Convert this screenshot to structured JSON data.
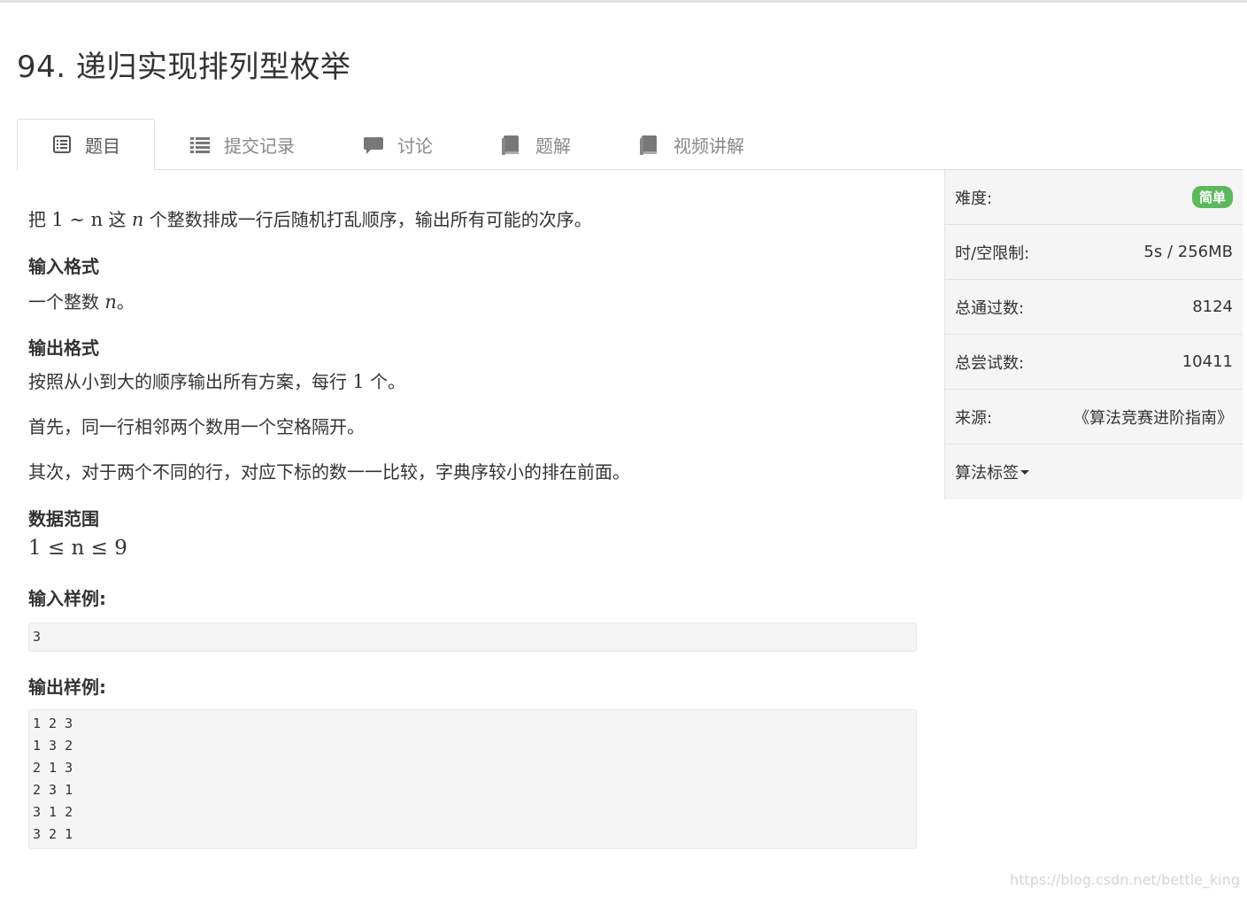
{
  "problem": {
    "title": "94. 递归实现排列型枚举"
  },
  "tabs": [
    {
      "label": "题目",
      "icon": "list-alt-icon",
      "active": true
    },
    {
      "label": "提交记录",
      "icon": "list-icon",
      "active": false
    },
    {
      "label": "讨论",
      "icon": "comment-icon",
      "active": false
    },
    {
      "label": "题解",
      "icon": "book-icon",
      "active": false
    },
    {
      "label": "视频讲解",
      "icon": "book-icon",
      "active": false
    }
  ],
  "statement": {
    "desc_pre": "把 ",
    "desc_math": "1 ∼ n",
    "desc_mid": " 这 ",
    "desc_math2": "n",
    "desc_post": " 个整数排成一行后随机打乱顺序，输出所有可能的次序。",
    "input_heading": "输入格式",
    "input_pre": "一个整数 ",
    "input_math": "n",
    "input_post": "。",
    "output_heading": "输出格式",
    "output_pre": "按照从小到大的顺序输出所有方案，每行 ",
    "output_math": "1",
    "output_post": " 个。",
    "output_p2": "首先，同一行相邻两个数用一个空格隔开。",
    "output_p3": "其次，对于两个不同的行，对应下标的数一一比较，字典序较小的排在前面。",
    "range_heading": "数据范围",
    "range_math": "1 ≤ n ≤ 9",
    "sample_input_heading": "输入样例:",
    "sample_input": [
      "3"
    ],
    "sample_output_heading": "输出样例:",
    "sample_output": [
      "1 2 3",
      "1 3 2",
      "2 1 3",
      "2 3 1",
      "3 1 2",
      "3 2 1"
    ]
  },
  "sidebar": {
    "difficulty_label": "难度:",
    "difficulty_value": "简单",
    "difficulty_color": "#5cb85c",
    "limit_label": "时/空限制:",
    "limit_value": "5s / 256MB",
    "accepted_label": "总通过数:",
    "accepted_value": "8124",
    "attempts_label": "总尝试数:",
    "attempts_value": "10411",
    "source_label": "来源:",
    "source_value": "《算法竞赛进阶指南》",
    "tags_label": "算法标签"
  },
  "watermark": "https://blog.csdn.net/bettle_king"
}
